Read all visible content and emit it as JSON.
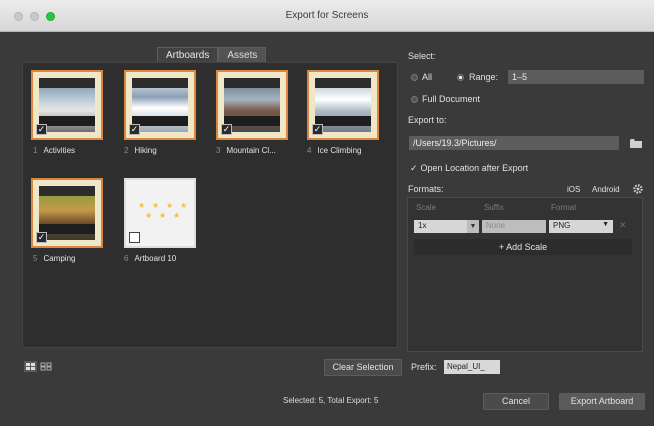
{
  "window": {
    "title": "Export for Screens"
  },
  "tabs": [
    {
      "label": "Artboards"
    },
    {
      "label": "Assets"
    }
  ],
  "artboards": [
    {
      "num": "1",
      "label": "Activities",
      "checked": true
    },
    {
      "num": "2",
      "label": "Hiking",
      "checked": true
    },
    {
      "num": "3",
      "label": "Mountain Cl...",
      "checked": true
    },
    {
      "num": "4",
      "label": "Ice Climbing",
      "checked": true
    },
    {
      "num": "5",
      "label": "Camping",
      "checked": true
    },
    {
      "num": "6",
      "label": "Artboard 10",
      "checked": false
    }
  ],
  "select": {
    "heading": "Select:",
    "all_label": "All",
    "range_label": "Range:",
    "range_value": "1–5",
    "full_doc_label": "Full Document"
  },
  "export_to": {
    "heading": "Export to:",
    "path": "/Users/19.3/Pictures/",
    "open_after_label": "Open Location after Export",
    "open_after_checked": true
  },
  "formats": {
    "heading": "Formats:",
    "platforms": [
      "iOS",
      "Android"
    ],
    "col_scale": "Scale",
    "col_suffix": "Suffix",
    "col_format": "Format",
    "scale_value": "1x",
    "suffix_placeholder": "None",
    "format_value": "PNG",
    "add_scale_label": "+ Add Scale"
  },
  "bottom": {
    "clear_selection_label": "Clear Selection",
    "prefix_label": "Prefix:",
    "prefix_value": "Nepal_UI_",
    "status": "Selected: 5, Total Export: 5",
    "cancel_label": "Cancel",
    "export_label": "Export Artboard"
  },
  "colors": {
    "accent_border": "#d9873e",
    "panel_bg": "#3a3a3a",
    "traffic_green": "#28c840"
  }
}
